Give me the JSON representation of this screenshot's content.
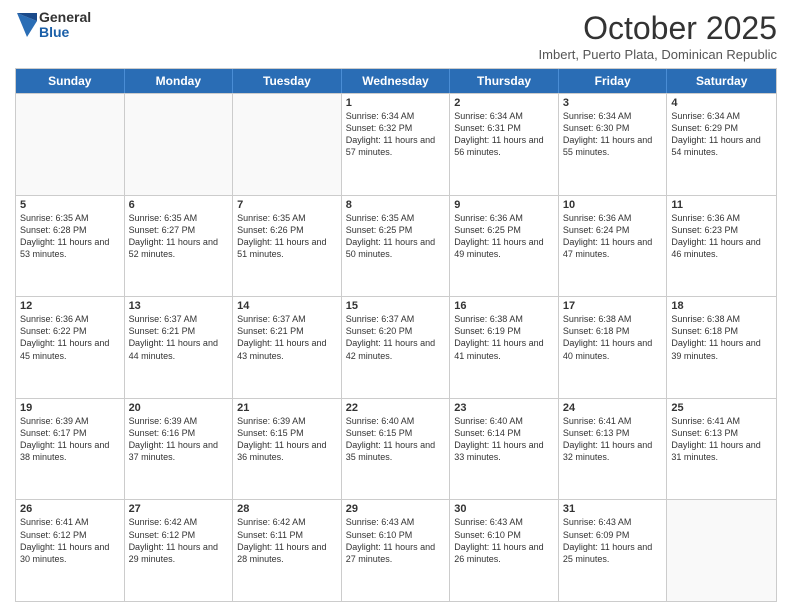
{
  "logo": {
    "general": "General",
    "blue": "Blue"
  },
  "title": "October 2025",
  "subtitle": "Imbert, Puerto Plata, Dominican Republic",
  "days": [
    "Sunday",
    "Monday",
    "Tuesday",
    "Wednesday",
    "Thursday",
    "Friday",
    "Saturday"
  ],
  "weeks": [
    [
      {
        "day": "",
        "info": ""
      },
      {
        "day": "",
        "info": ""
      },
      {
        "day": "",
        "info": ""
      },
      {
        "day": "1",
        "info": "Sunrise: 6:34 AM\nSunset: 6:32 PM\nDaylight: 11 hours and 57 minutes."
      },
      {
        "day": "2",
        "info": "Sunrise: 6:34 AM\nSunset: 6:31 PM\nDaylight: 11 hours and 56 minutes."
      },
      {
        "day": "3",
        "info": "Sunrise: 6:34 AM\nSunset: 6:30 PM\nDaylight: 11 hours and 55 minutes."
      },
      {
        "day": "4",
        "info": "Sunrise: 6:34 AM\nSunset: 6:29 PM\nDaylight: 11 hours and 54 minutes."
      }
    ],
    [
      {
        "day": "5",
        "info": "Sunrise: 6:35 AM\nSunset: 6:28 PM\nDaylight: 11 hours and 53 minutes."
      },
      {
        "day": "6",
        "info": "Sunrise: 6:35 AM\nSunset: 6:27 PM\nDaylight: 11 hours and 52 minutes."
      },
      {
        "day": "7",
        "info": "Sunrise: 6:35 AM\nSunset: 6:26 PM\nDaylight: 11 hours and 51 minutes."
      },
      {
        "day": "8",
        "info": "Sunrise: 6:35 AM\nSunset: 6:25 PM\nDaylight: 11 hours and 50 minutes."
      },
      {
        "day": "9",
        "info": "Sunrise: 6:36 AM\nSunset: 6:25 PM\nDaylight: 11 hours and 49 minutes."
      },
      {
        "day": "10",
        "info": "Sunrise: 6:36 AM\nSunset: 6:24 PM\nDaylight: 11 hours and 47 minutes."
      },
      {
        "day": "11",
        "info": "Sunrise: 6:36 AM\nSunset: 6:23 PM\nDaylight: 11 hours and 46 minutes."
      }
    ],
    [
      {
        "day": "12",
        "info": "Sunrise: 6:36 AM\nSunset: 6:22 PM\nDaylight: 11 hours and 45 minutes."
      },
      {
        "day": "13",
        "info": "Sunrise: 6:37 AM\nSunset: 6:21 PM\nDaylight: 11 hours and 44 minutes."
      },
      {
        "day": "14",
        "info": "Sunrise: 6:37 AM\nSunset: 6:21 PM\nDaylight: 11 hours and 43 minutes."
      },
      {
        "day": "15",
        "info": "Sunrise: 6:37 AM\nSunset: 6:20 PM\nDaylight: 11 hours and 42 minutes."
      },
      {
        "day": "16",
        "info": "Sunrise: 6:38 AM\nSunset: 6:19 PM\nDaylight: 11 hours and 41 minutes."
      },
      {
        "day": "17",
        "info": "Sunrise: 6:38 AM\nSunset: 6:18 PM\nDaylight: 11 hours and 40 minutes."
      },
      {
        "day": "18",
        "info": "Sunrise: 6:38 AM\nSunset: 6:18 PM\nDaylight: 11 hours and 39 minutes."
      }
    ],
    [
      {
        "day": "19",
        "info": "Sunrise: 6:39 AM\nSunset: 6:17 PM\nDaylight: 11 hours and 38 minutes."
      },
      {
        "day": "20",
        "info": "Sunrise: 6:39 AM\nSunset: 6:16 PM\nDaylight: 11 hours and 37 minutes."
      },
      {
        "day": "21",
        "info": "Sunrise: 6:39 AM\nSunset: 6:15 PM\nDaylight: 11 hours and 36 minutes."
      },
      {
        "day": "22",
        "info": "Sunrise: 6:40 AM\nSunset: 6:15 PM\nDaylight: 11 hours and 35 minutes."
      },
      {
        "day": "23",
        "info": "Sunrise: 6:40 AM\nSunset: 6:14 PM\nDaylight: 11 hours and 33 minutes."
      },
      {
        "day": "24",
        "info": "Sunrise: 6:41 AM\nSunset: 6:13 PM\nDaylight: 11 hours and 32 minutes."
      },
      {
        "day": "25",
        "info": "Sunrise: 6:41 AM\nSunset: 6:13 PM\nDaylight: 11 hours and 31 minutes."
      }
    ],
    [
      {
        "day": "26",
        "info": "Sunrise: 6:41 AM\nSunset: 6:12 PM\nDaylight: 11 hours and 30 minutes."
      },
      {
        "day": "27",
        "info": "Sunrise: 6:42 AM\nSunset: 6:12 PM\nDaylight: 11 hours and 29 minutes."
      },
      {
        "day": "28",
        "info": "Sunrise: 6:42 AM\nSunset: 6:11 PM\nDaylight: 11 hours and 28 minutes."
      },
      {
        "day": "29",
        "info": "Sunrise: 6:43 AM\nSunset: 6:10 PM\nDaylight: 11 hours and 27 minutes."
      },
      {
        "day": "30",
        "info": "Sunrise: 6:43 AM\nSunset: 6:10 PM\nDaylight: 11 hours and 26 minutes."
      },
      {
        "day": "31",
        "info": "Sunrise: 6:43 AM\nSunset: 6:09 PM\nDaylight: 11 hours and 25 minutes."
      },
      {
        "day": "",
        "info": ""
      }
    ]
  ]
}
